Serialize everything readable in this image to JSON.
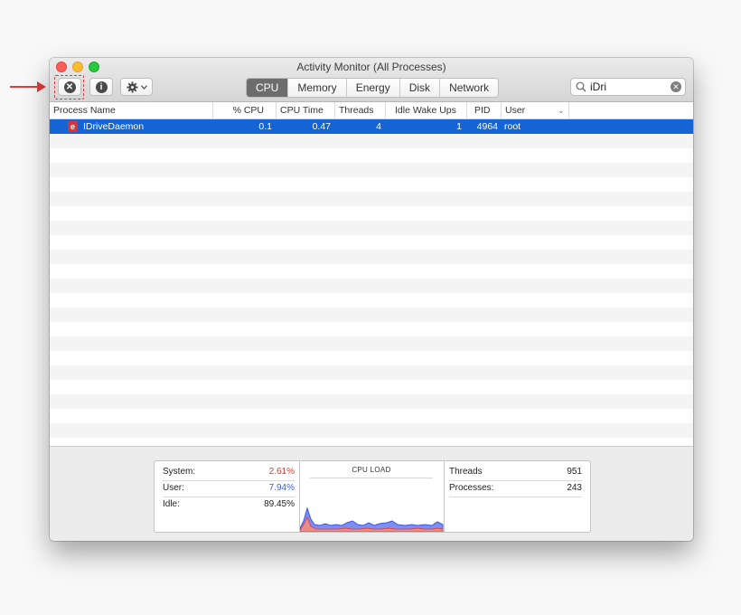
{
  "window": {
    "title": "Activity Monitor (All Processes)"
  },
  "toolbar": {
    "quit_icon": "x-circle-icon",
    "info_icon": "info-icon",
    "gear_icon": "gear-icon",
    "tabs": [
      {
        "label": "CPU",
        "active": true
      },
      {
        "label": "Memory",
        "active": false
      },
      {
        "label": "Energy",
        "active": false
      },
      {
        "label": "Disk",
        "active": false
      },
      {
        "label": "Network",
        "active": false
      }
    ],
    "search_value": "iDri"
  },
  "table": {
    "columns": [
      "Process Name",
      "% CPU",
      "CPU Time",
      "Threads",
      "Idle Wake Ups",
      "PID",
      "User"
    ],
    "rows": [
      {
        "name": "IDriveDaemon",
        "cpu": "0.1",
        "cpu_time": "0.47",
        "threads": "4",
        "idle_wake_ups": "1",
        "pid": "4964",
        "user": "root"
      }
    ]
  },
  "stats": {
    "system_label": "System:",
    "system_value": "2.61%",
    "user_label": "User:",
    "user_value": "7.94%",
    "idle_label": "Idle:",
    "idle_value": "89.45%",
    "cpu_load_title": "CPU LOAD",
    "threads_label": "Threads",
    "threads_value": "951",
    "processes_label": "Processes:",
    "processes_value": "243"
  },
  "colors": {
    "selection": "#1464d6",
    "system": "#e0312c",
    "user": "#2f5fe0",
    "annotation": "#e23b3b"
  }
}
